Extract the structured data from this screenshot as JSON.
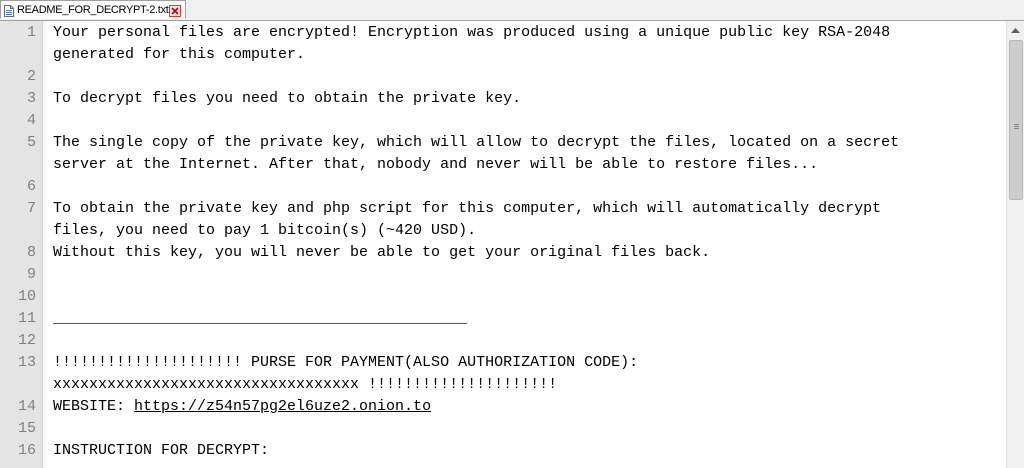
{
  "tab": {
    "filename": "README_FOR_DECRYPT-2.txt",
    "icon": "text-document-icon",
    "close_icon": "close-icon"
  },
  "editor": {
    "rows": [
      {
        "num": "1",
        "text": "Your personal files are encrypted! Encryption was produced using a unique public key RSA-2048"
      },
      {
        "num": "",
        "text": "generated for this computer."
      },
      {
        "num": "2",
        "text": ""
      },
      {
        "num": "3",
        "text": "To decrypt files you need to obtain the private key."
      },
      {
        "num": "4",
        "text": ""
      },
      {
        "num": "5",
        "text": "The single copy of the private key, which will allow to decrypt the files, located on a secret"
      },
      {
        "num": "",
        "text": "server at the Internet. After that, nobody and never will be able to restore files..."
      },
      {
        "num": "6",
        "text": ""
      },
      {
        "num": "7",
        "text": "To obtain the private key and php script for this computer, which will automatically decrypt"
      },
      {
        "num": "",
        "text": "files, you need to pay 1 bitcoin(s) (~420 USD)."
      },
      {
        "num": "8",
        "text": "Without this key, you will never be able to get your original files back."
      },
      {
        "num": "9",
        "text": ""
      },
      {
        "num": "10",
        "text": ""
      },
      {
        "num": "11",
        "text": "______________________________________________"
      },
      {
        "num": "12",
        "text": ""
      },
      {
        "num": "13",
        "text": "!!!!!!!!!!!!!!!!!!!!! PURSE FOR PAYMENT(ALSO AUTHORIZATION CODE):"
      },
      {
        "num": "",
        "text": "xxxxxxxxxxxxxxxxxxxxxxxxxxxxxxxxxx !!!!!!!!!!!!!!!!!!!!!"
      },
      {
        "num": "14",
        "text": "WEBSITE: ",
        "link": "https://z54n57pg2el6uze2.onion.to"
      },
      {
        "num": "15",
        "text": ""
      },
      {
        "num": "16",
        "text": "INSTRUCTION FOR DECRYPT:"
      }
    ]
  }
}
